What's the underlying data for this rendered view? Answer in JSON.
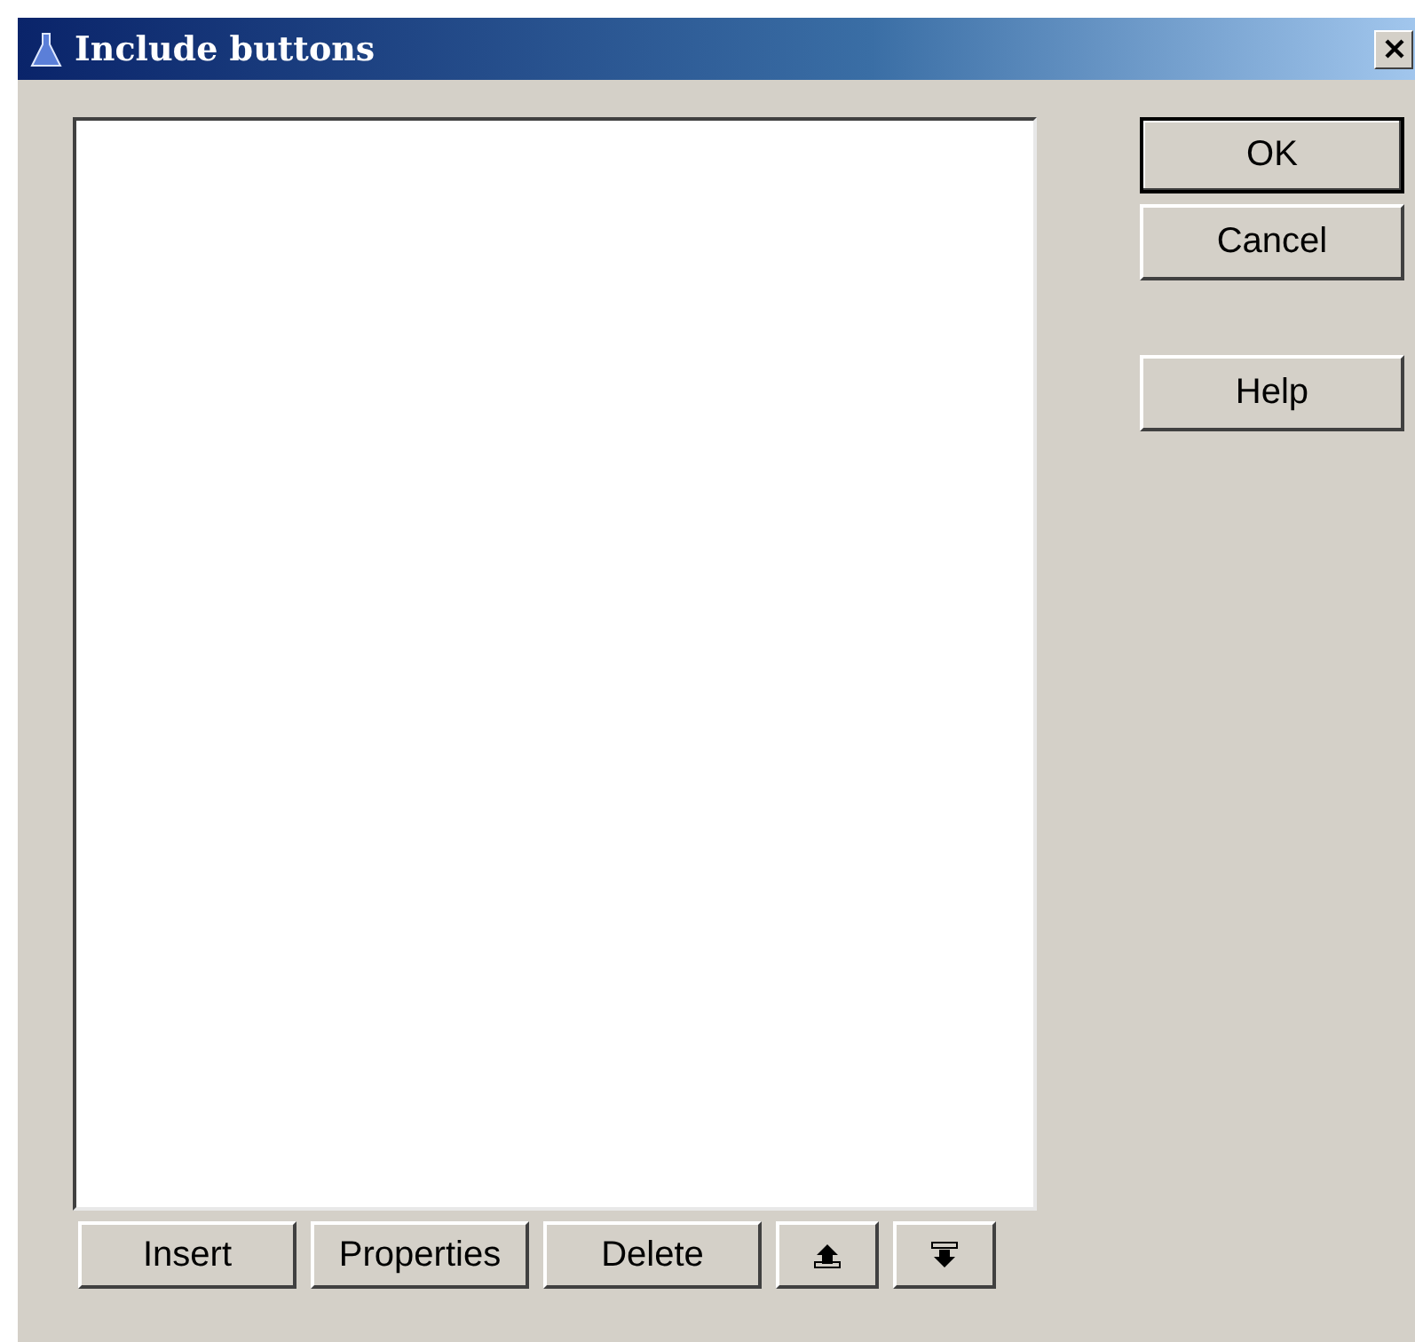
{
  "window": {
    "title": "Include buttons"
  },
  "side_buttons": [
    {
      "label": "OK",
      "default": true
    },
    {
      "label": "Cancel",
      "default": false
    },
    {
      "label": "Help",
      "default": false
    }
  ],
  "bottom_buttons": [
    {
      "kind": "text",
      "label": "Insert"
    },
    {
      "kind": "text",
      "label": "Properties"
    },
    {
      "kind": "text",
      "label": "Delete"
    },
    {
      "kind": "up"
    },
    {
      "kind": "down"
    }
  ]
}
